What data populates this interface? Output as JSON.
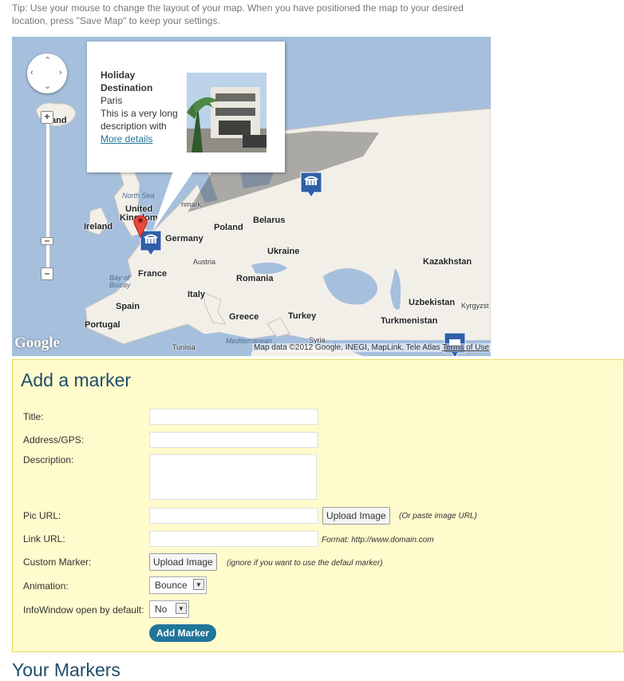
{
  "tip": "Tip: Use your mouse to change the layout of your map. When you have positioned the map to your desired location, press \"Save Map\" to keep your settings.",
  "map": {
    "labels": {
      "iceland": "land",
      "north_sea": "North Sea",
      "united_kingdom_1": "United",
      "united_kingdom_2": "Kingdom",
      "denmark": "nmark",
      "ireland": "Ireland",
      "belarus": "Belarus",
      "poland": "Poland",
      "germany": "Germany",
      "ukraine": "Ukraine",
      "austria": "Austria",
      "kazakhstan": "Kazakhstan",
      "france": "France",
      "bay_of_biscay_1": "Bay of",
      "bay_of_biscay_2": "Biscay",
      "romania": "Romania",
      "italy": "Italy",
      "uzbekistan": "Uzbekistan",
      "kyrgyz": "Kyrgyzst",
      "spain": "Spain",
      "greece": "Greece",
      "turkey": "Turkey",
      "turkmenistan": "Turkmenistan",
      "portugal": "Portugal",
      "tunisia": "Tunisia",
      "mediterranean": "Mediterranean",
      "syria": "Syria"
    },
    "popup": {
      "title": "Holiday Destination",
      "city": "Paris",
      "description": "This is a very long description with",
      "link": "More details"
    },
    "google_logo": "Google",
    "credits": "Map data ©2012 Google, INEGI, MapLink, Tele Atlas",
    "terms": "Terms of Use",
    "colors": {
      "water": "#a5bfdd",
      "land": "#f2efe9",
      "marker_blue": "#2f5fa8",
      "pin_red": "#e8493f"
    }
  },
  "form": {
    "heading": "Add a marker",
    "title_label": "Title:",
    "address_label": "Address/GPS:",
    "description_label": "Description:",
    "pic_label": "Pic URL:",
    "upload_image": "Upload Image",
    "pic_hint": "(Or paste image URL)",
    "link_label": "Link URL:",
    "link_hint": "Format: http://www.domain.com",
    "custom_marker_label": "Custom Marker:",
    "custom_marker_button": "Upload Image",
    "custom_marker_hint": "(ignore if you want to use the defaul marker)",
    "animation_label": "Animation:",
    "animation_value": "Bounce",
    "infowindow_label": "InfoWindow open by default:",
    "infowindow_value": "No",
    "add_button": "Add Marker"
  },
  "footer_heading": "Your Markers"
}
